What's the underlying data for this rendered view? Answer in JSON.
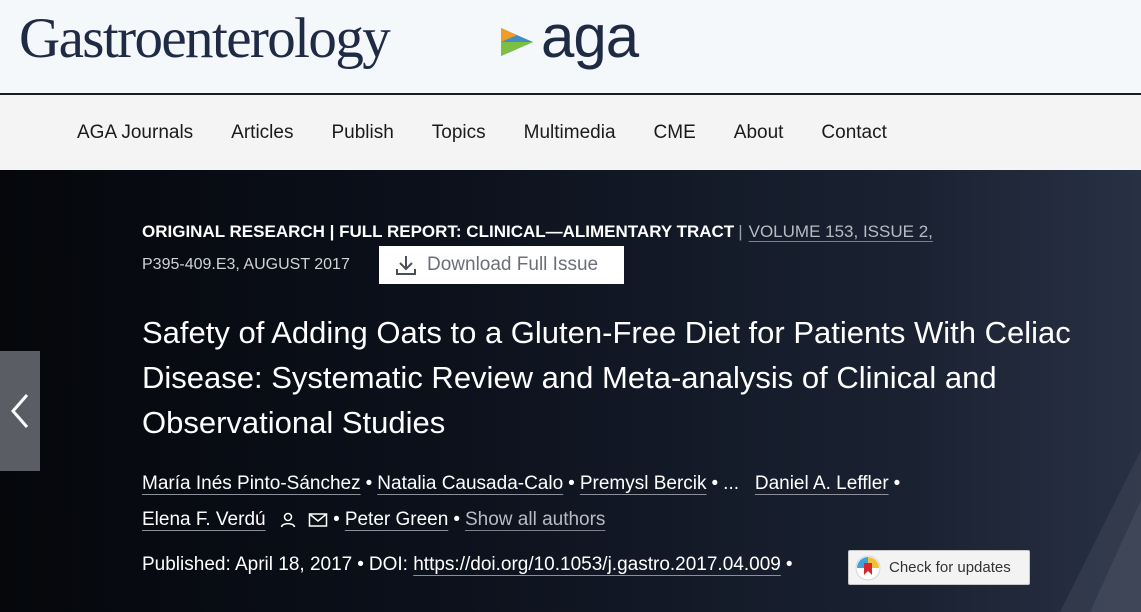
{
  "header": {
    "journal_name": "Gastroenterology",
    "publisher_logo_text": "aga",
    "colors": {
      "navy": "#1f2a44",
      "aga_blue": "#3f8fc4",
      "aga_green": "#7cbf43",
      "aga_orange": "#f29b26"
    }
  },
  "nav": {
    "items": [
      "AGA Journals",
      "Articles",
      "Publish",
      "Topics",
      "Multimedia",
      "CME",
      "About",
      "Contact"
    ]
  },
  "article": {
    "category": "ORIGINAL RESEARCH | FULL REPORT: CLINICAL—ALIMENTARY TRACT",
    "separator": "|",
    "volume_issue": "VOLUME 153, ISSUE 2,",
    "pages_date": "P395-409.E3, AUGUST 2017",
    "download_label": "Download Full Issue",
    "title": "Safety of Adding Oats to a Gluten-Free Diet for Patients With Celiac Disease: Systematic Review and Meta-analysis of Clinical and Observational Studies",
    "authors": [
      "María Inés Pinto-Sánchez",
      "Natalia Causada-Calo",
      "Premysl Bercik",
      "Daniel A. Leffler",
      "Elena F. Verdú",
      "Peter Green"
    ],
    "ellipsis": "...",
    "show_all_label": "Show all authors",
    "published_label": "Published: April 18, 2017",
    "doi_label": "DOI:",
    "doi_url": "https://doi.org/10.1053/j.gastro.2017.04.009",
    "check_updates_label": "Check for updates"
  },
  "icons": {
    "prev": "chevron-left-icon",
    "download": "download-icon",
    "person": "person-icon",
    "mail": "mail-icon",
    "check_updates": "crossmark-icon"
  }
}
